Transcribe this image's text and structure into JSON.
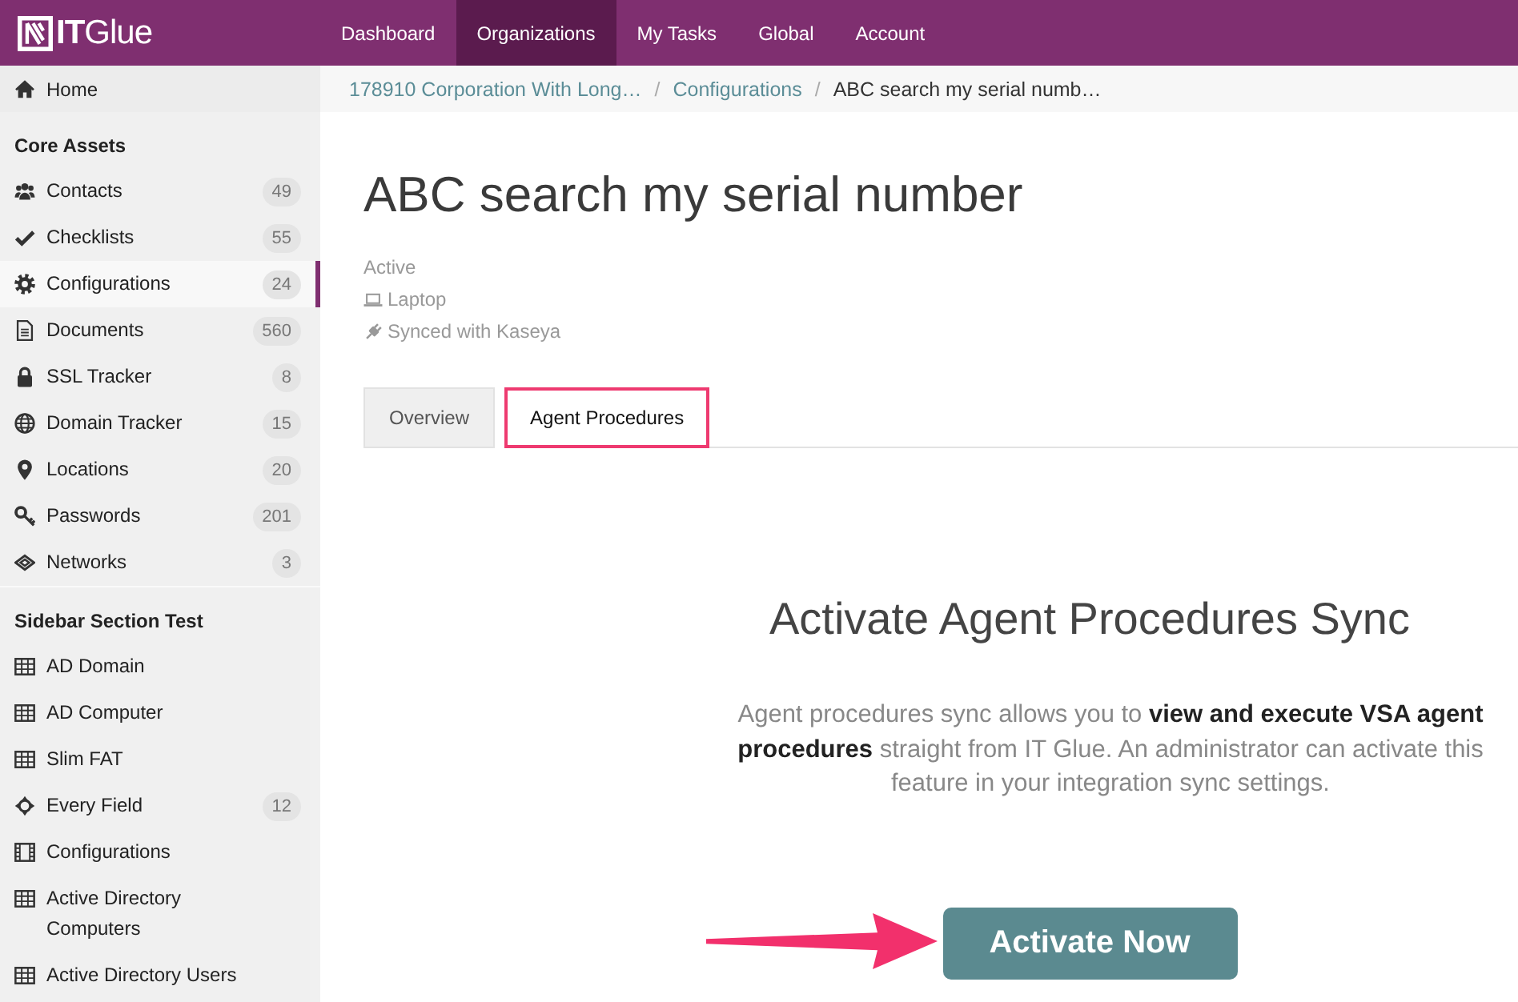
{
  "app": {
    "logo": "**IT**Glue"
  },
  "nav": [
    {
      "label": "Dashboard",
      "selected": false
    },
    {
      "label": "Organizations",
      "selected": true
    },
    {
      "label": "My Tasks",
      "selected": false
    },
    {
      "label": "Global",
      "selected": false
    },
    {
      "label": "Account",
      "selected": false
    }
  ],
  "breadcrumb": [
    {
      "label": "178910 Corporation With Long…",
      "kind": "link",
      "separator": "/"
    },
    {
      "label": "Configurations",
      "kind": "link",
      "separator": "/"
    },
    {
      "label": "ABC search my serial numb…",
      "kind": "current"
    }
  ],
  "sidebar": {
    "home": {
      "label": "Home"
    },
    "sections": [
      {
        "title": "Core Assets",
        "items": [
          {
            "label": "Contacts",
            "count": "49",
            "selected": false
          },
          {
            "label": "Checklists",
            "count": "55",
            "selected": false
          },
          {
            "label": "Configurations",
            "count": "24",
            "selected": true
          },
          {
            "label": "Documents",
            "count": "560",
            "selected": false
          },
          {
            "label": "SSL Tracker",
            "count": "8",
            "selected": false
          },
          {
            "label": "Domain Tracker",
            "count": "15",
            "selected": false
          },
          {
            "label": "Locations",
            "count": "20",
            "selected": false
          },
          {
            "label": "Passwords",
            "count": "201",
            "selected": false
          },
          {
            "label": "Networks",
            "count": "3",
            "selected": false
          }
        ]
      },
      {
        "title": "Sidebar Section Test",
        "items": [
          {
            "label": "AD Domain",
            "selected": false
          },
          {
            "label": "AD Computer",
            "selected": false
          },
          {
            "label": "Slim FAT",
            "selected": false
          },
          {
            "label": "Every Field",
            "count": "12",
            "selected": false
          },
          {
            "label": "Configurations",
            "selected": false
          },
          {
            "label": "Active Directory Computers",
            "selected": false
          },
          {
            "label": "Active Directory Users",
            "selected": false
          }
        ]
      }
    ]
  },
  "page": {
    "title": "ABC search my serial number",
    "meta": [
      {
        "label": "Active"
      },
      {
        "label": "Laptop"
      },
      {
        "label": "Synced with Kaseya"
      }
    ]
  },
  "tabs": [
    {
      "label": "Overview",
      "selected": false,
      "highlighted": false
    },
    {
      "label": "Agent Procedures",
      "selected": true,
      "highlighted": true
    }
  ],
  "panel": {
    "heading": "Activate Agent Procedures Sync",
    "text": "Agent procedures sync allows you to **view and execute VSA agent procedures** straight from IT Glue. An administrator can activate this feature in your integration sync settings.",
    "button": {
      "label": "Activate Now",
      "arrow": true
    }
  }
}
